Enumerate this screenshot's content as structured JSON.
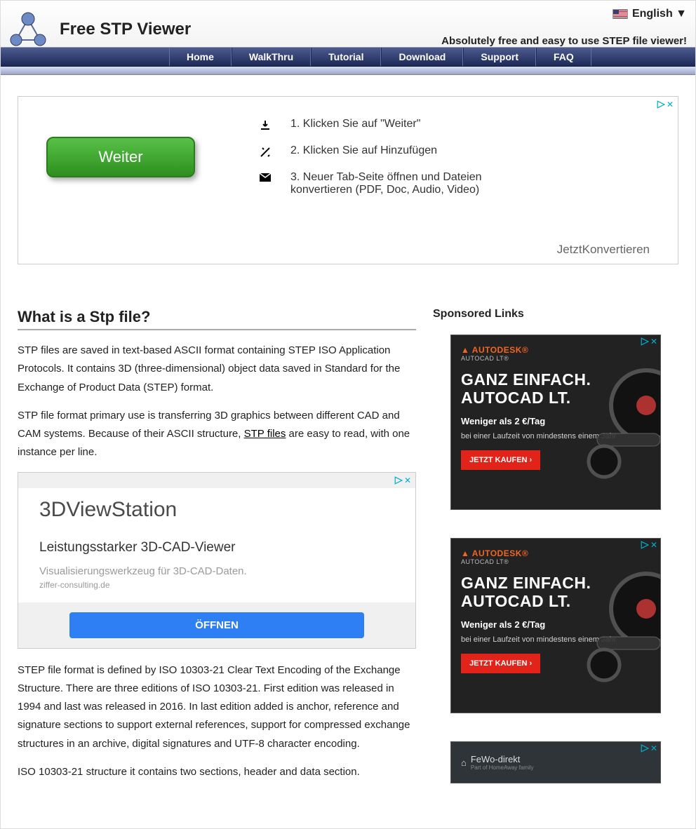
{
  "header": {
    "title": "Free STP Viewer",
    "language_label": "English ▼",
    "tagline": "Absolutely free and easy to use STEP file viewer!"
  },
  "nav": {
    "items": [
      "Home",
      "WalkThru",
      "Tutorial",
      "Download",
      "Support",
      "FAQ"
    ]
  },
  "ad_top": {
    "button": "Weiter",
    "steps": [
      "1. Klicken Sie auf \"Weiter\"",
      "2. Klicken Sie auf Hinzufügen",
      "3. Neuer Tab-Seite öffnen und Dateien konvertieren (PDF, Doc, Audio, Video)"
    ],
    "brand": "JetztKonvertieren"
  },
  "article": {
    "heading": "What is a Stp file?",
    "p1": "STP files are saved in text-based ASCII format containing STEP ISO Application Protocols. It contains 3D (three-dimensional) object data saved in Standard for the Exchange of Product Data (STEP) format.",
    "p2a": "STP file format primary use is transferring 3D graphics between different CAD and CAM systems. Because of their ASCII structure, ",
    "p2_link": "STP files",
    "p2b": " are easy to read, with one instance per line.",
    "p3": "STEP file format is defined by ISO 10303-21 Clear Text Encoding of the Exchange Structure. There are three editions of ISO 10303-21. First edition was released in 1994 and last was released in 2016. In last edition added is anchor, reference and signature sections to support external references, support for compressed exchange structures in an archive, digital signatures and UTF-8 character encoding.",
    "p4": "ISO 10303-21 structure it contains two sections, header and data section."
  },
  "ad_mid": {
    "title": "3DViewStation",
    "subtitle": "Leistungsstarker 3D-CAD-Viewer",
    "desc": "Visualisierungswerkzeug für 3D-CAD-Daten.",
    "url": "ziffer-consulting.de",
    "button": "ÖFFNEN"
  },
  "sidebar": {
    "heading": "Sponsored Links",
    "autocad": {
      "brand_top": "AUTODESK®",
      "brand_sub": "AUTOCAD LT®",
      "headline": "GANZ EINFACH. AUTOCAD LT.",
      "sub": "Weniger als 2 €/Tag",
      "small": "bei einer Laufzeit von mindestens einem Jahr",
      "cta": "JETZT KAUFEN  ›"
    },
    "fewo": {
      "brand": "FeWo-direkt",
      "tag": "Part of HomeAway family"
    }
  }
}
